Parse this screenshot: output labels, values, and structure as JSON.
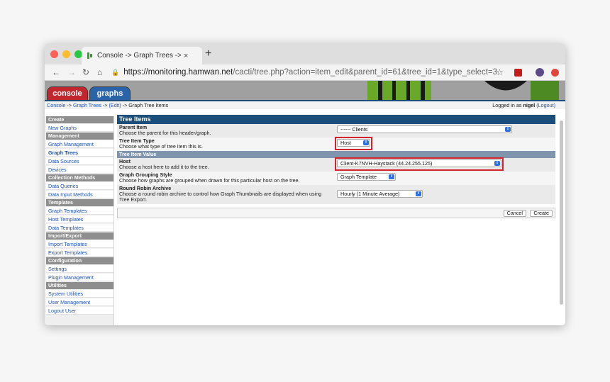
{
  "browser": {
    "tab_title": "Console -> Graph Trees -> (Edit)",
    "tab_close": "×",
    "new_tab": "+",
    "url_host": "https://monitoring.hamwan.net",
    "url_path": "/cacti/tree.php?action=item_edit&parent_id=61&tree_id=1&type_select=3",
    "nav_back": "←",
    "nav_forward": "→",
    "nav_reload": "↻",
    "nav_home": "⌂",
    "star": "☆",
    "colors": {
      "close": "#fe5f57",
      "min": "#febc2e",
      "max": "#28c840"
    }
  },
  "banner": {
    "console_label": "console",
    "graphs_label": "graphs"
  },
  "breadcrumb": {
    "console": "Console",
    "sep1": " -> ",
    "graph_trees": "Graph Trees",
    "sep2": " -> ",
    "edit": "(Edit)",
    "sep3": " -> ",
    "current": "Graph Tree Items",
    "login_prefix": "Logged in as ",
    "user": "nigel",
    "logout": "(Logout)"
  },
  "sidebar": {
    "sections": [
      {
        "title": "Create",
        "items": [
          "New Graphs"
        ]
      },
      {
        "title": "Management",
        "items": [
          "Graph Management",
          "Graph Trees",
          "Data Sources",
          "Devices"
        ]
      },
      {
        "title": "Collection Methods",
        "items": [
          "Data Queries",
          "Data Input Methods"
        ]
      },
      {
        "title": "Templates",
        "items": [
          "Graph Templates",
          "Host Templates",
          "Data Templates"
        ]
      },
      {
        "title": "Import/Export",
        "items": [
          "Import Templates",
          "Export Templates"
        ]
      },
      {
        "title": "Configuration",
        "items": [
          "Settings",
          "Plugin Management"
        ]
      },
      {
        "title": "Utilities",
        "items": [
          "System Utilities",
          "User Management",
          "Logout User"
        ]
      }
    ],
    "active": "Graph Trees"
  },
  "form": {
    "title": "Tree Items",
    "parent_item": {
      "label": "Parent Item",
      "desc": "Choose the parent for this header/graph.",
      "value": "------ Clients"
    },
    "tree_item_type": {
      "label": "Tree Item Type",
      "desc": "Choose what type of tree item this is.",
      "value": "Host"
    },
    "section": "Tree Item Value",
    "host": {
      "label": "Host",
      "desc": "Choose a host here to add it to the tree.",
      "value": "Client-K7NVH-Haystack (44.24.255.125)"
    },
    "grouping": {
      "label": "Graph Grouping Style",
      "desc": "Choose how graphs are grouped when drawn for this particular host on the tree.",
      "value": "Graph Template"
    },
    "rra": {
      "label": "Round Robin Archive",
      "desc": "Choose a round robin archive to control how Graph Thumbnails are displayed when using Tree Export.",
      "value": "Hourly (1 Minute Average)"
    },
    "cancel": "Cancel",
    "create": "Create"
  }
}
